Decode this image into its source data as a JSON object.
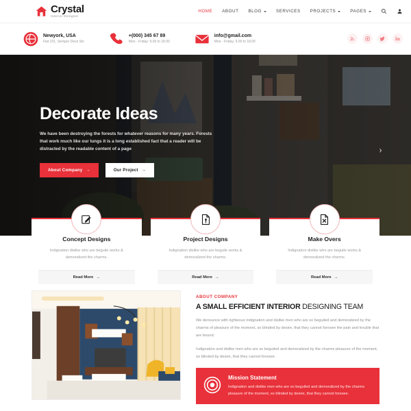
{
  "brand": {
    "name": "Crystal",
    "tagline": "Interior Designer",
    "icon": "home-icon",
    "accent": "#e8313a"
  },
  "nav": {
    "items": [
      {
        "label": "HOME",
        "active": true,
        "caret": false
      },
      {
        "label": "ABOUT",
        "active": false,
        "caret": false
      },
      {
        "label": "BLOG",
        "active": false,
        "caret": true
      },
      {
        "label": "SERVICES",
        "active": false,
        "caret": false
      },
      {
        "label": "PROJECTS",
        "active": false,
        "caret": true
      },
      {
        "label": "PAGES",
        "active": false,
        "caret": true
      }
    ],
    "search_icon": "search-icon",
    "account_icon": "user-icon"
  },
  "contact": {
    "address": {
      "icon": "globe-icon",
      "title": "Newyork, USA",
      "sub": "Flat 231, Semper Deck Stv"
    },
    "phone": {
      "icon": "phone-icon",
      "title": "+(000) 345 67 89",
      "sub": "Mon - Friday: 9.00 to 18.00"
    },
    "email": {
      "icon": "envelope-icon",
      "title": "info@gmail.com",
      "sub": "Mon - Friday: 9.00 to 18.00"
    },
    "socials": [
      "rss-icon",
      "instagram-icon",
      "twitter-icon",
      "linkedin-icon"
    ]
  },
  "hero": {
    "title": "Decorate Ideas",
    "description": "We have been destroying the forests for whatever reasons for many years. Forests that work much like our lungs it is a long established fact that a reader will be distracted by the readable content of a page",
    "primary_button": "About Company",
    "secondary_button": "Our Project",
    "arrow": "→",
    "next_slide_icon": "chevron-right-icon",
    "next_slide_glyph": "›"
  },
  "services": {
    "read_more": "Read More",
    "arrow": "→",
    "cards": [
      {
        "icon": "pencil-square-icon",
        "title": "Concept Designs",
        "description": "Indignation dislike who are beguile works & demoralized the charms."
      },
      {
        "icon": "document-pin-icon",
        "title": "Project Designs",
        "description": "Indignation dislike who are beguile works & demoralized the charms."
      },
      {
        "icon": "document-x-icon",
        "title": "Make Overs",
        "description": "Indignation dislike who are beguile works & demoralized the charms."
      }
    ]
  },
  "about": {
    "image_alt": "modern living room interior with blue accent wall",
    "kicker": "ABOUT COMPANY",
    "heading_bold": "A SMALL EFFICIENT INTERIOR",
    "heading_light": " DESIGNING TEAM",
    "paragraph1": "We denounce with righteous indignation and dislike men who are so beguiled and demoralized by the charms of pleasure of the moment, so blinded by desire, that they cannot foresee the pain and trouble that are bound.",
    "paragraph2": "Indignation and dislike men who are so beguiled and demoralized by the charms pleasure of the moment, so blinded by desire, that they cannot foresee.",
    "mission": {
      "icon": "target-icon",
      "title": "Mission Statement",
      "description": "Indignation and dislike men who are so beguiled and demoralized by the charms pleasure of the moment, so blinded by desire, that they cannot foresee."
    }
  }
}
